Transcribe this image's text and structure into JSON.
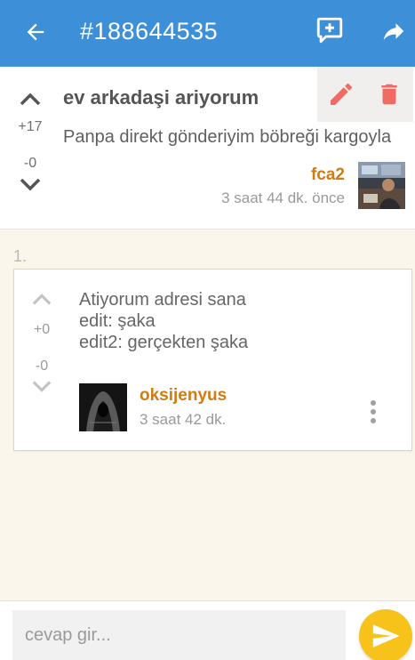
{
  "appbar": {
    "title": "#188644535",
    "back_icon": "arrow-left-icon",
    "add_comment_icon": "comment-plus-icon",
    "share_icon": "share-icon",
    "color": "#3d8fd8"
  },
  "post": {
    "title": "ev arkadaşi ariyorum",
    "body": "Panpa direkt gönderiyim böbreği kargoyla",
    "upvotes": "+17",
    "downvotes": "-0",
    "author": "fca2",
    "time": "3 saat 44 dk. önce",
    "edit_icon": "pencil-icon",
    "delete_icon": "trash-icon"
  },
  "comments": [
    {
      "index": "1.",
      "lines": [
        "Atiyorum adresi sana",
        "edit: şaka",
        "edit2: gerçekten şaka"
      ],
      "upvotes": "+0",
      "downvotes": "-0",
      "author": "oksijenyus",
      "time": "3 saat 42 dk.",
      "more_icon": "more-vertical-icon"
    }
  ],
  "reply": {
    "placeholder": "cevap gir...",
    "send_icon": "send-icon",
    "send_color": "#f7c31b"
  },
  "accent": "#d07b14"
}
